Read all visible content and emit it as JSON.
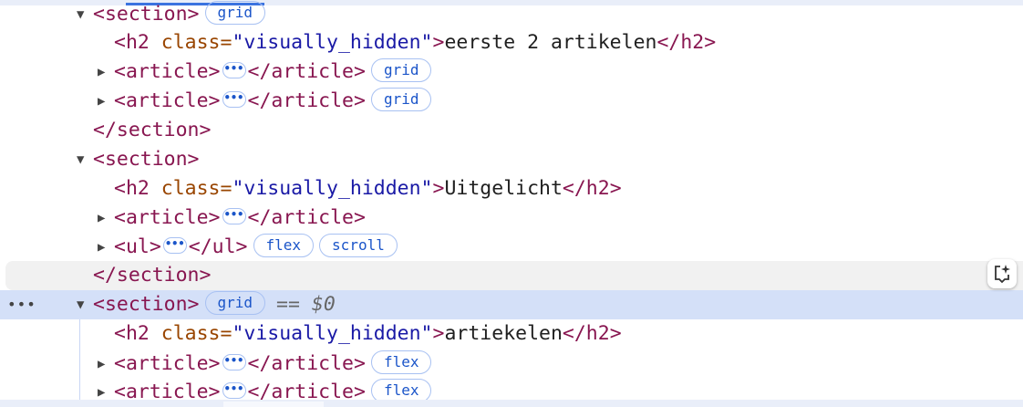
{
  "rows": [
    {
      "open": "<section>",
      "badge": "grid"
    },
    {
      "h2_open": "<h2 ",
      "attr": "class=",
      "val": "\"visually_hidden\"",
      "gt": ">",
      "text": "eerste 2 artikelen",
      "close": "</h2>"
    },
    {
      "open": "<article>",
      "ellipsis": "•••",
      "close": "</article>",
      "badge": "grid"
    },
    {
      "open": "<article>",
      "ellipsis": "•••",
      "close": "</article>",
      "badge": "grid"
    },
    {
      "close": "</section>"
    },
    {
      "open": "<section>"
    },
    {
      "h2_open": "<h2 ",
      "attr": "class=",
      "val": "\"visually_hidden\"",
      "gt": ">",
      "text": "Uitgelicht",
      "close": "</h2>"
    },
    {
      "open": "<article>",
      "ellipsis": "•••",
      "close": "</article>"
    },
    {
      "open": "<ul>",
      "ellipsis": "•••",
      "close": "</ul>",
      "badge": "flex",
      "badge2": "scroll"
    },
    {
      "close": "</section>"
    },
    {
      "open": "<section>",
      "badge": "grid",
      "eq": "==",
      "ref": "$0",
      "dots": "•••"
    },
    {
      "h2_open": "<h2 ",
      "attr": "class=",
      "val": "\"visually_hidden\"",
      "gt": ">",
      "text": "artiekelen",
      "close": "</h2>"
    },
    {
      "open": "<article>",
      "ellipsis": "•••",
      "close": "</article>",
      "badge": "flex"
    },
    {
      "open": "<article>",
      "ellipsis": "•••",
      "close": "</article>",
      "badge": "flex"
    }
  ],
  "colors": {
    "tag": "#881650",
    "attr": "#994500",
    "value": "#1a1aa6",
    "badge": "#1b55c9",
    "selected": "#d4e0f8"
  }
}
